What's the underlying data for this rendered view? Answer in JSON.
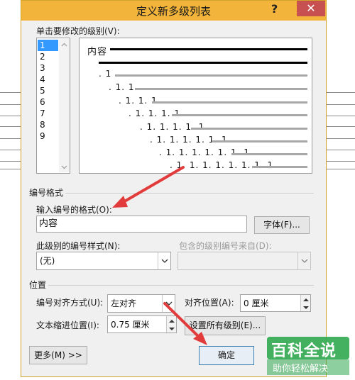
{
  "dialog": {
    "title": "定义新多级列表",
    "help_label": "?",
    "close_label": "✕"
  },
  "levels": {
    "label": "单击要修改的级别(V):",
    "items": [
      "1",
      "2",
      "3",
      "4",
      "5",
      "6",
      "7",
      "8",
      "9"
    ],
    "selected": "1"
  },
  "preview": {
    "heading": "内容",
    "lines": [
      ". 1",
      ". 1. 1",
      ". 1. 1. 1",
      ". 1. 1. 1. 1",
      ". 1. 1. 1. 1. 1",
      ". 1. 1. 1. 1. 1. 1",
      ". 1. 1. 1. 1. 1. 1. 1",
      ". 1. 1. 1. 1. 1. 1. 1. 1"
    ]
  },
  "format": {
    "section_label": "编号格式",
    "input_label": "输入编号的格式(O):",
    "input_value": "内容",
    "font_button": "字体(F)...",
    "style_label": "此级别的编号样式(N):",
    "style_value": "(无)",
    "include_label": "包含的级别编号来自(D):",
    "include_value": ""
  },
  "position": {
    "section_label": "位置",
    "align_label": "编号对齐方式(U):",
    "align_value": "左对齐",
    "align_at_label": "对齐位置(A):",
    "align_at_value": "0 厘米",
    "indent_label": "文本缩进位置(I):",
    "indent_value": "0.75 厘米",
    "set_all_button": "设置所有级别(E)..."
  },
  "footer": {
    "more_button": "更多(M) >>",
    "ok_button": "确定"
  },
  "watermark": {
    "logo": "百科全说",
    "tagline": "助你轻松解决"
  },
  "colors": {
    "titlebar": "#f2b43a",
    "close": "#c75050",
    "selection": "#3399ff",
    "arrow": "#e23b3b"
  }
}
